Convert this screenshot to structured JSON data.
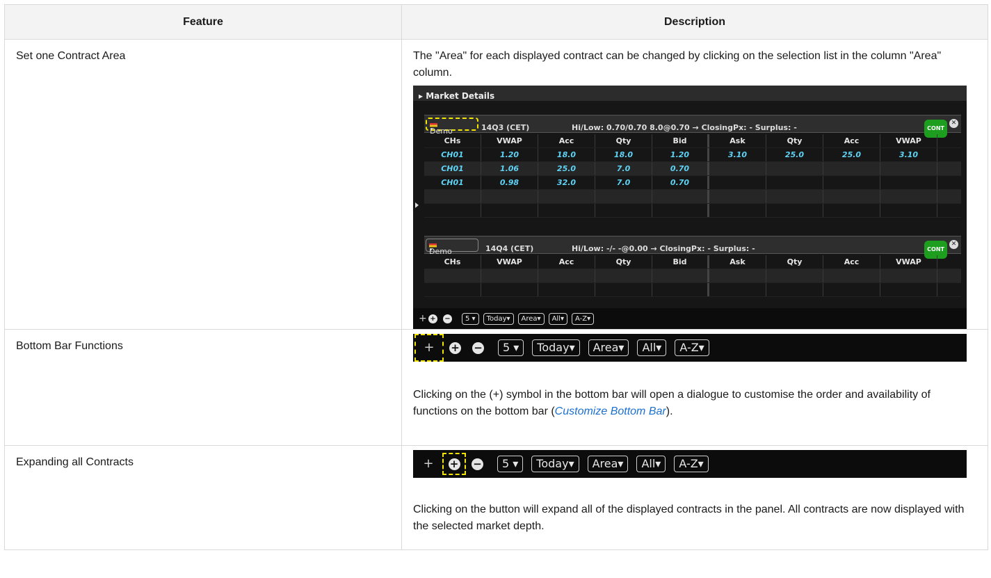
{
  "table": {
    "headers": [
      "Feature",
      "Description"
    ],
    "rows": [
      {
        "feature": "Set one Contract Area",
        "description": "The \"Area\" for each displayed contract can be changed by clicking on the selection list in the column \"Area\" column."
      },
      {
        "feature": "Bottom Bar Functions",
        "description_before": "Clicking on the (+) symbol in the bottom bar will open a dialogue to customise the order and availability of functions on the bottom bar (",
        "link": "Customize Bottom Bar",
        "description_after": ")."
      },
      {
        "feature": "Expanding all Contracts",
        "description": "Clicking on the button will expand all of the displayed contracts in the panel. All contracts are now displayed with the selected market depth."
      }
    ]
  },
  "panel": {
    "title": "Market Details",
    "contracts": [
      {
        "area": "Demo",
        "name": "14Q3 (CET)",
        "stats": "Hi/Low:  0.70/0.70   8.0@0.70 → ClosingPx: - Surplus: -",
        "badge": "CONT",
        "columns": [
          "CHs",
          "VWAP",
          "Acc",
          "Qty",
          "Bid",
          "Ask",
          "Qty",
          "Acc",
          "VWAP"
        ],
        "rows": [
          [
            "CH01",
            "1.20",
            "18.0",
            "18.0",
            "1.20",
            "3.10",
            "25.0",
            "25.0",
            "3.10"
          ],
          [
            "CH01",
            "1.06",
            "25.0",
            "7.0",
            "0.70",
            "",
            "",
            "",
            ""
          ],
          [
            "CH01",
            "0.98",
            "32.0",
            "7.0",
            "0.70",
            "",
            "",
            "",
            ""
          ]
        ]
      },
      {
        "area": "Demo",
        "name": "14Q4 (CET)",
        "stats": "Hi/Low:  -/-   -@0.00 → ClosingPx: - Surplus: -",
        "badge": "CONT",
        "columns": [
          "CHs",
          "VWAP",
          "Acc",
          "Qty",
          "Bid",
          "Ask",
          "Qty",
          "Acc",
          "VWAP"
        ]
      }
    ]
  },
  "bottom_bar": {
    "plus": "+",
    "expand": "+",
    "collapse": "−",
    "depth": "5 ▾",
    "day": "Today▾",
    "area": "Area▾",
    "filter": "All▾",
    "sort": "A-Z▾"
  },
  "colors": {
    "highlight": "#f2e600",
    "values": "#5fd3f5",
    "badge": "#1e9e1e",
    "link": "#1a6fd1"
  }
}
